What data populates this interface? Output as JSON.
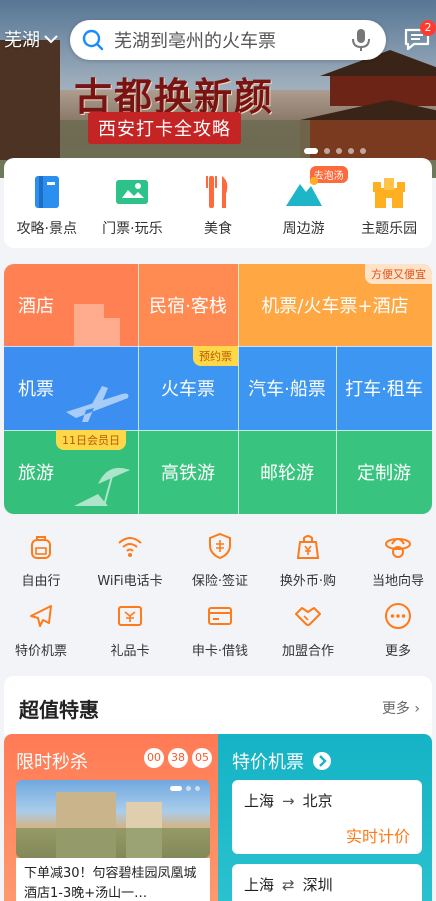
{
  "header": {
    "city": "芜湖",
    "search_placeholder": "芜湖到亳州的火车票",
    "message_badge": "2"
  },
  "banner": {
    "title": "古都换新颜",
    "subtitle": "西安打卡全攻略"
  },
  "categories": [
    {
      "label": "攻略·景点",
      "icon": "guide-book-icon"
    },
    {
      "label": "门票·玩乐",
      "icon": "ticket-icon"
    },
    {
      "label": "美食",
      "icon": "fork-knife-icon"
    },
    {
      "label": "周边游",
      "icon": "mountain-icon",
      "tag": "去泡汤"
    },
    {
      "label": "主题乐园",
      "icon": "castle-icon"
    }
  ],
  "grid": {
    "hotel": "酒店",
    "homestay": "民宿·客栈",
    "flight_train_hotel": "机票/火车票+酒店",
    "flight_train_hotel_chip": "方便又便宜",
    "flight": "机票",
    "train": "火车票",
    "train_chip": "预约票",
    "bus_ship": "汽车·船票",
    "taxi_rental": "打车·租车",
    "travel": "旅游",
    "travel_chip": "11日会员日",
    "high_speed": "高铁游",
    "cruise": "邮轮游",
    "custom": "定制游"
  },
  "tools": [
    {
      "label": "自由行",
      "icon": "backpack-icon"
    },
    {
      "label": "WiFi电话卡",
      "icon": "wifi-icon"
    },
    {
      "label": "保险·签证",
      "icon": "shield-icon"
    },
    {
      "label": "换外币·购",
      "icon": "currency-bag-icon"
    },
    {
      "label": "当地向导",
      "icon": "guide-hat-icon"
    },
    {
      "label": "特价机票",
      "icon": "airplane-icon"
    },
    {
      "label": "礼品卡",
      "icon": "gift-card-icon"
    },
    {
      "label": "申卡·借钱",
      "icon": "credit-card-icon"
    },
    {
      "label": "加盟合作",
      "icon": "handshake-icon"
    },
    {
      "label": "更多",
      "icon": "more-icon"
    }
  ],
  "deals": {
    "title": "超值特惠",
    "more": "更多",
    "flash_title": "限时秒杀",
    "timer": [
      "00",
      "38",
      "05"
    ],
    "flash_desc": "下单减30！句容碧桂园凤凰城酒店1-3晚+汤山一…",
    "air_title": "特价机票",
    "routes": [
      {
        "from": "上海",
        "arrow": "→",
        "to": "北京",
        "price": "实时计价"
      },
      {
        "from": "上海",
        "arrow": "⇄",
        "to": "深圳"
      }
    ]
  },
  "colors": {
    "hotel": "#ff7a4a",
    "flight": "#3d8ef0",
    "travel": "#36c47a",
    "accent_orange": "#ff7a1a"
  }
}
